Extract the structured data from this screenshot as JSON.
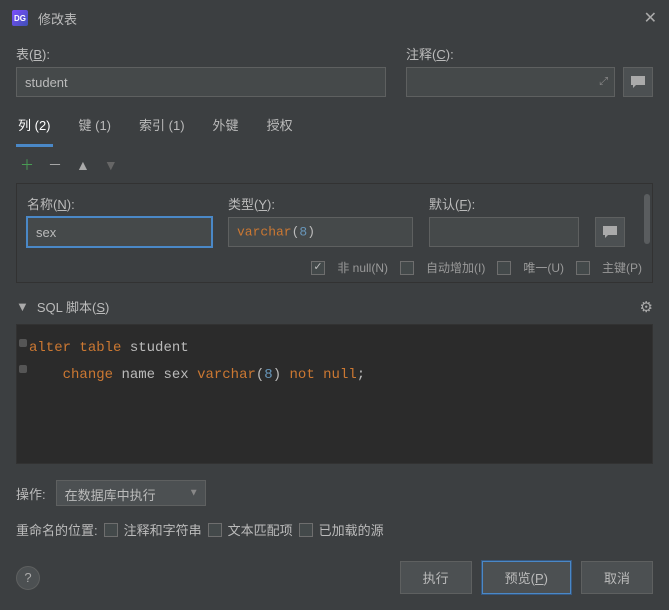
{
  "title": "修改表",
  "tableLabel": "表(",
  "tableMnemonic": "B",
  "tableLabelEnd": "):",
  "tableName": "student",
  "commentLabel": "注释(",
  "commentMnemonic": "C",
  "commentLabelEnd": "):",
  "tabs": {
    "columns": "列 (2)",
    "keys": "键 (1)",
    "indexes": "索引 (1)",
    "foreign": "外键",
    "grants": "授权"
  },
  "colFields": {
    "nameLabel": "名称(",
    "nameMnemonic": "N",
    "nameLabelEnd": "):",
    "nameValue": "sex",
    "typeLabel": "类型(",
    "typeMnemonic": "Y",
    "typeLabelEnd": "):",
    "typeKw": "varchar",
    "typeNum": "8",
    "defaultLabel": "默认(",
    "defaultMnemonic": "F",
    "defaultLabelEnd": "):"
  },
  "checkboxes": {
    "notNull": "非 null(N)",
    "autoInc": "自动增加(I)",
    "unique": "唯一(U)",
    "primary": "主键(P)"
  },
  "scriptLabel": "SQL 脚本(",
  "scriptMnemonic": "S",
  "scriptLabelEnd": ")",
  "sql": {
    "alter": "alter",
    "table": "table",
    "student": "student",
    "change": "change",
    "name": "name",
    "sex": "sex",
    "varchar": "varchar",
    "eight": "8",
    "not": "not",
    "null": "null"
  },
  "actionLabel": "操作:",
  "actionValue": "在数据库中执行",
  "renameLabel": "重命名的位置:",
  "renameOpts": {
    "comments": "注释和字符串",
    "text": "文本匹配项",
    "loaded": "已加载的源"
  },
  "buttons": {
    "execute": "执行",
    "preview": "预览(",
    "previewMnemonic": "P",
    "previewEnd": ")",
    "cancel": "取消"
  }
}
